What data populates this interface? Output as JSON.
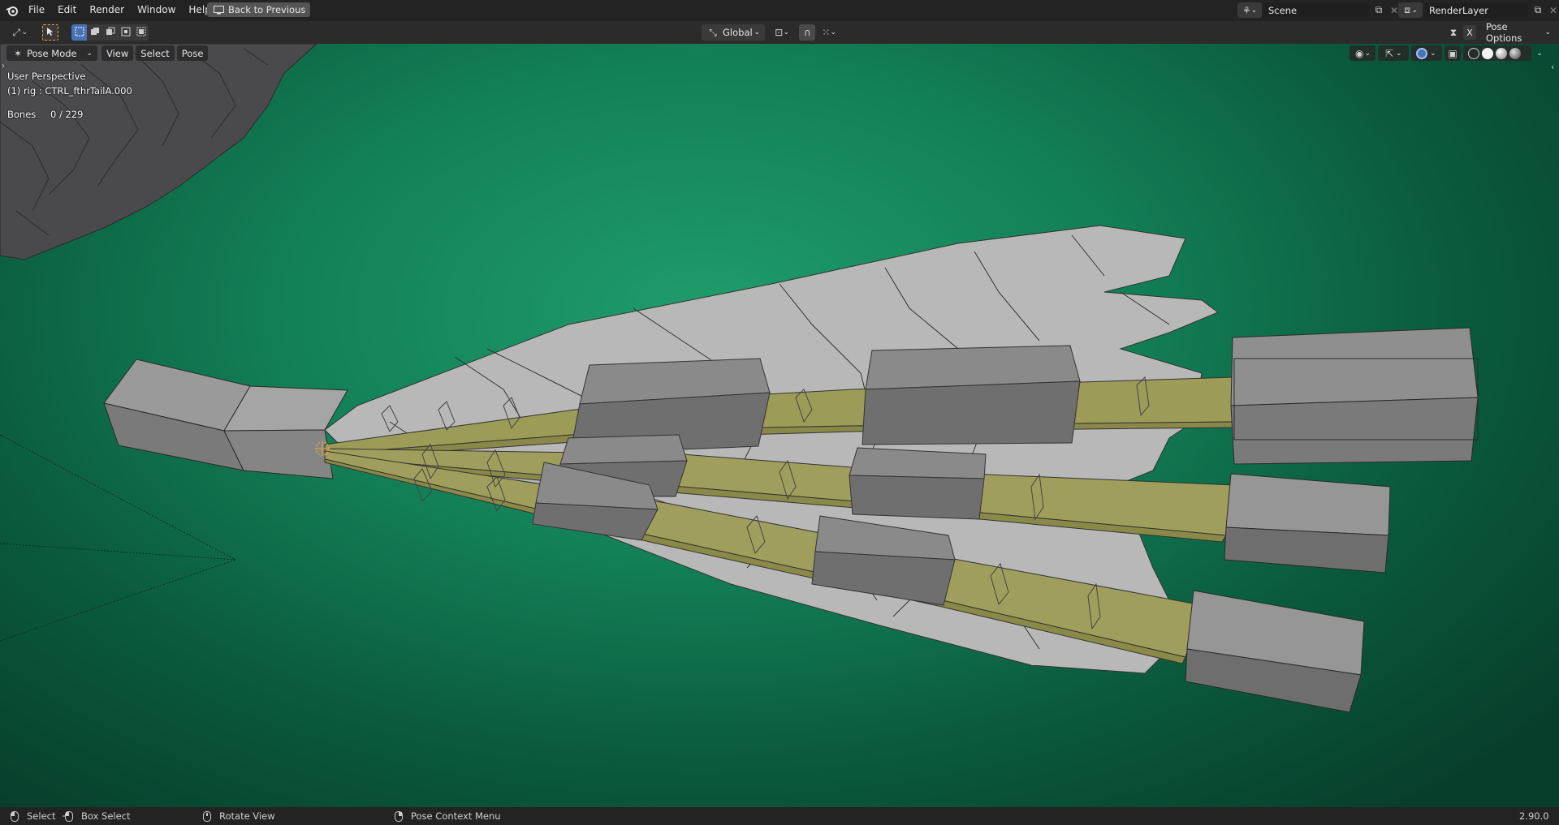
{
  "menubar": {
    "app_icon": "blender-logo-icon",
    "items": [
      "File",
      "Edit",
      "Render",
      "Window",
      "Help"
    ],
    "back_button": "Back to Previous",
    "scene_label": "Scene",
    "render_layer_label": "RenderLayer"
  },
  "toolbar": {
    "transform_orientation": "Global",
    "pose_options": "Pose Options",
    "x_label": "X"
  },
  "viewport_header": {
    "mode": "Pose Mode",
    "menus": [
      "View",
      "Select",
      "Pose"
    ]
  },
  "overlay": {
    "perspective": "User Perspective",
    "object_info": "(1) rig : CTRL_fthrTailA.000",
    "bones_label": "Bones",
    "bones_value": "0 / 229"
  },
  "statusbar": {
    "select": "Select",
    "box_select": "Box Select",
    "rotate_view": "Rotate View",
    "context_menu": "Pose Context Menu",
    "version": "2.90.0"
  },
  "colors": {
    "viewport_bg": "#138058",
    "bone_fill": "#9a9a5a",
    "mesh_light": "#b9b9b9",
    "widget_gray": "#7d7d7d",
    "active_select": "#e8a23a"
  }
}
